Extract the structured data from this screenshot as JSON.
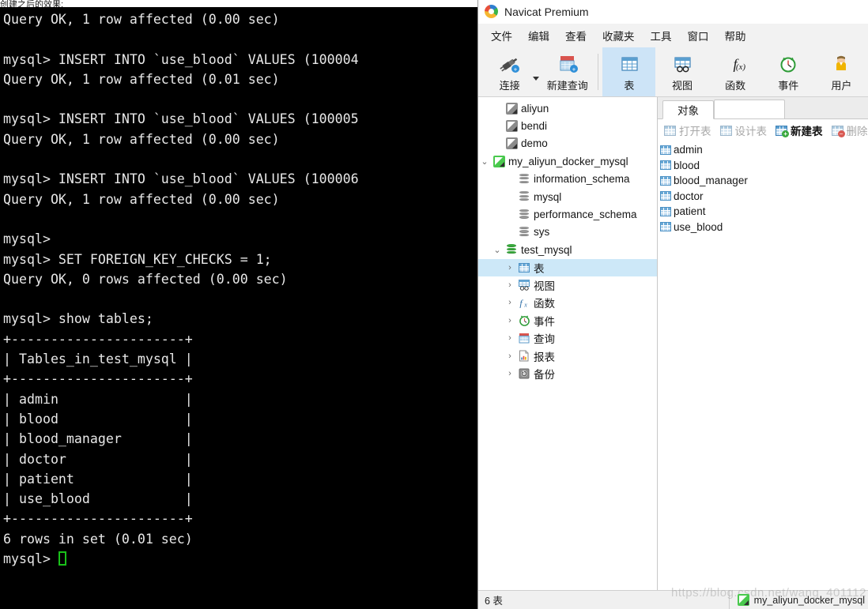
{
  "terminal": {
    "top_sliver_text": "创建之后的效果:",
    "lines": "Query OK, 1 row affected (0.00 sec)\n\nmysql> INSERT INTO `use_blood` VALUES (100004\nQuery OK, 1 row affected (0.01 sec)\n\nmysql> INSERT INTO `use_blood` VALUES (100005\nQuery OK, 1 row affected (0.00 sec)\n\nmysql> INSERT INTO `use_blood` VALUES (100006\nQuery OK, 1 row affected (0.00 sec)\n\nmysql>\nmysql> SET FOREIGN_KEY_CHECKS = 1;\nQuery OK, 0 rows affected (0.00 sec)\n\nmysql> show tables;\n+----------------------+\n| Tables_in_test_mysql |\n+----------------------+\n| admin                |\n| blood                |\n| blood_manager        |\n| doctor               |\n| patient              |\n| use_blood            |\n+----------------------+\n6 rows in set (0.01 sec)\n",
    "prompt": "mysql> "
  },
  "navicat": {
    "title": "Navicat Premium",
    "logo_icon": "navicat-logo-icon",
    "menubar": [
      {
        "label": "文件",
        "name": "menu-file"
      },
      {
        "label": "编辑",
        "name": "menu-edit"
      },
      {
        "label": "查看",
        "name": "menu-view"
      },
      {
        "label": "收藏夹",
        "name": "menu-favorites"
      },
      {
        "label": "工具",
        "name": "menu-tools"
      },
      {
        "label": "窗口",
        "name": "menu-window"
      },
      {
        "label": "帮助",
        "name": "menu-help"
      }
    ],
    "toolbar": [
      {
        "label": "连接",
        "name": "toolbar-connection",
        "icon": "plug-icon",
        "selected": false,
        "has_caret": true
      },
      {
        "label": "新建查询",
        "name": "toolbar-new-query",
        "icon": "new-query-icon",
        "selected": false,
        "has_caret": false
      },
      {
        "label": "表",
        "name": "toolbar-table",
        "icon": "table-icon",
        "selected": true,
        "has_caret": false
      },
      {
        "label": "视图",
        "name": "toolbar-view",
        "icon": "view-icon",
        "selected": false,
        "has_caret": false
      },
      {
        "label": "函数",
        "name": "toolbar-function",
        "icon": "fx-icon",
        "selected": false,
        "has_caret": false
      },
      {
        "label": "事件",
        "name": "toolbar-event",
        "icon": "clock-icon",
        "selected": false,
        "has_caret": false
      },
      {
        "label": "用户",
        "name": "toolbar-user",
        "icon": "user-icon",
        "selected": false,
        "has_caret": false
      }
    ],
    "tree": [
      {
        "label": "aliyun",
        "name": "tree-connection-aliyun",
        "icon": "connection-icon",
        "icon_state": "inactive",
        "indent": 1,
        "arrow": "none"
      },
      {
        "label": "bendi",
        "name": "tree-connection-bendi",
        "icon": "connection-icon",
        "icon_state": "inactive",
        "indent": 1,
        "arrow": "none"
      },
      {
        "label": "demo",
        "name": "tree-connection-demo",
        "icon": "connection-icon",
        "icon_state": "inactive",
        "indent": 1,
        "arrow": "none"
      },
      {
        "label": "my_aliyun_docker_mysql",
        "name": "tree-connection-my-aliyun-docker-mysql",
        "icon": "connection-icon",
        "icon_state": "active",
        "indent": 0,
        "arrow": "down"
      },
      {
        "label": "information_schema",
        "name": "tree-db-information-schema",
        "icon": "database-icon",
        "icon_state": "grey",
        "indent": 2,
        "arrow": "none"
      },
      {
        "label": "mysql",
        "name": "tree-db-mysql",
        "icon": "database-icon",
        "icon_state": "grey",
        "indent": 2,
        "arrow": "none"
      },
      {
        "label": "performance_schema",
        "name": "tree-db-performance-schema",
        "icon": "database-icon",
        "icon_state": "grey",
        "indent": 2,
        "arrow": "none"
      },
      {
        "label": "sys",
        "name": "tree-db-sys",
        "icon": "database-icon",
        "icon_state": "grey",
        "indent": 2,
        "arrow": "none"
      },
      {
        "label": "test_mysql",
        "name": "tree-db-test-mysql",
        "icon": "database-icon",
        "icon_state": "green",
        "indent": 1,
        "arrow": "down"
      },
      {
        "label": "表",
        "name": "tree-node-tables",
        "icon": "table-icon",
        "icon_state": "blue",
        "indent": 2,
        "arrow": "right",
        "selected": true
      },
      {
        "label": "视图",
        "name": "tree-node-views",
        "icon": "view-icon",
        "icon_state": "blue",
        "indent": 2,
        "arrow": "right"
      },
      {
        "label": "函数",
        "name": "tree-node-functions",
        "icon": "fx-icon",
        "icon_state": "blue",
        "indent": 2,
        "arrow": "right"
      },
      {
        "label": "事件",
        "name": "tree-node-events",
        "icon": "clock-icon",
        "icon_state": "green",
        "indent": 2,
        "arrow": "right"
      },
      {
        "label": "查询",
        "name": "tree-node-queries",
        "icon": "query-icon",
        "icon_state": "red",
        "indent": 2,
        "arrow": "right"
      },
      {
        "label": "报表",
        "name": "tree-node-reports",
        "icon": "report-icon",
        "icon_state": "grey",
        "indent": 2,
        "arrow": "right"
      },
      {
        "label": "备份",
        "name": "tree-node-backups",
        "icon": "backup-icon",
        "icon_state": "grey",
        "indent": 2,
        "arrow": "right"
      }
    ],
    "object_panel": {
      "tab_label": "对象",
      "actions": [
        {
          "label": "打开表",
          "name": "open-table-button",
          "state": "disabled",
          "badge": "none"
        },
        {
          "label": "设计表",
          "name": "design-table-button",
          "state": "disabled",
          "badge": "pencil"
        },
        {
          "label": "新建表",
          "name": "new-table-button",
          "state": "enabled",
          "badge": "plus"
        },
        {
          "label": "删除表",
          "name": "delete-table-button",
          "state": "disabled",
          "badge": "minus"
        }
      ],
      "tables": [
        "admin",
        "blood",
        "blood_manager",
        "doctor",
        "patient",
        "use_blood"
      ]
    },
    "statusbar": {
      "left_text": "6 表",
      "connection_name": "my_aliyun_docker_mysql",
      "connection_icon": "connection-icon",
      "watermark": "https://blog.csdn.net/wang_401112"
    }
  }
}
